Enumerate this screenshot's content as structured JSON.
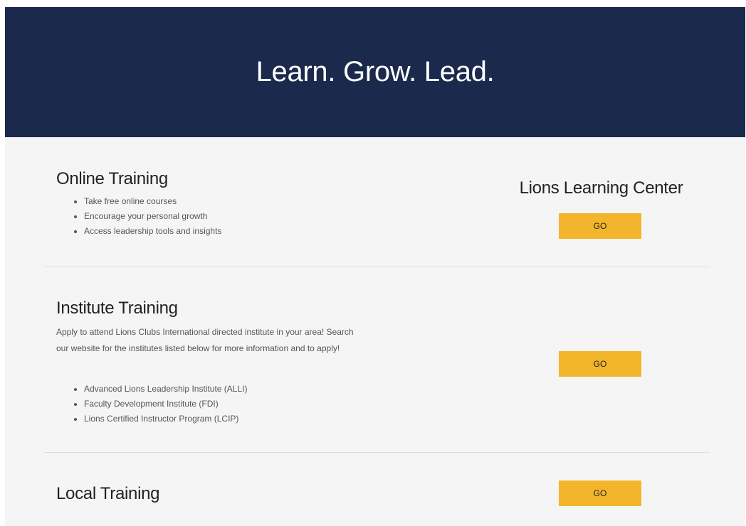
{
  "hero": {
    "title": "Learn. Grow. Lead.",
    "background_color": "#1b2a4c"
  },
  "sections": {
    "online": {
      "title": "Online Training",
      "items": [
        "Take free online courses",
        "Encourage your personal growth",
        "Access leadership tools and insights"
      ],
      "side_title": "Lions Learning Center",
      "button_label": "GO"
    },
    "institute": {
      "title": "Institute Training",
      "description": "Apply to attend Lions Clubs International directed institute in your area! Search our website for the institutes listed below for more information and to apply!",
      "items": [
        "Advanced Lions Leadership Institute (ALLI)",
        "Faculty Development Institute (FDI)",
        "Lions Certified Instructor Program (LCIP)"
      ],
      "button_label": "GO"
    },
    "local": {
      "title": "Local Training",
      "button_label": "GO"
    }
  },
  "colors": {
    "accent_button": "#f2b52b",
    "page_background": "#f5f5f5"
  }
}
